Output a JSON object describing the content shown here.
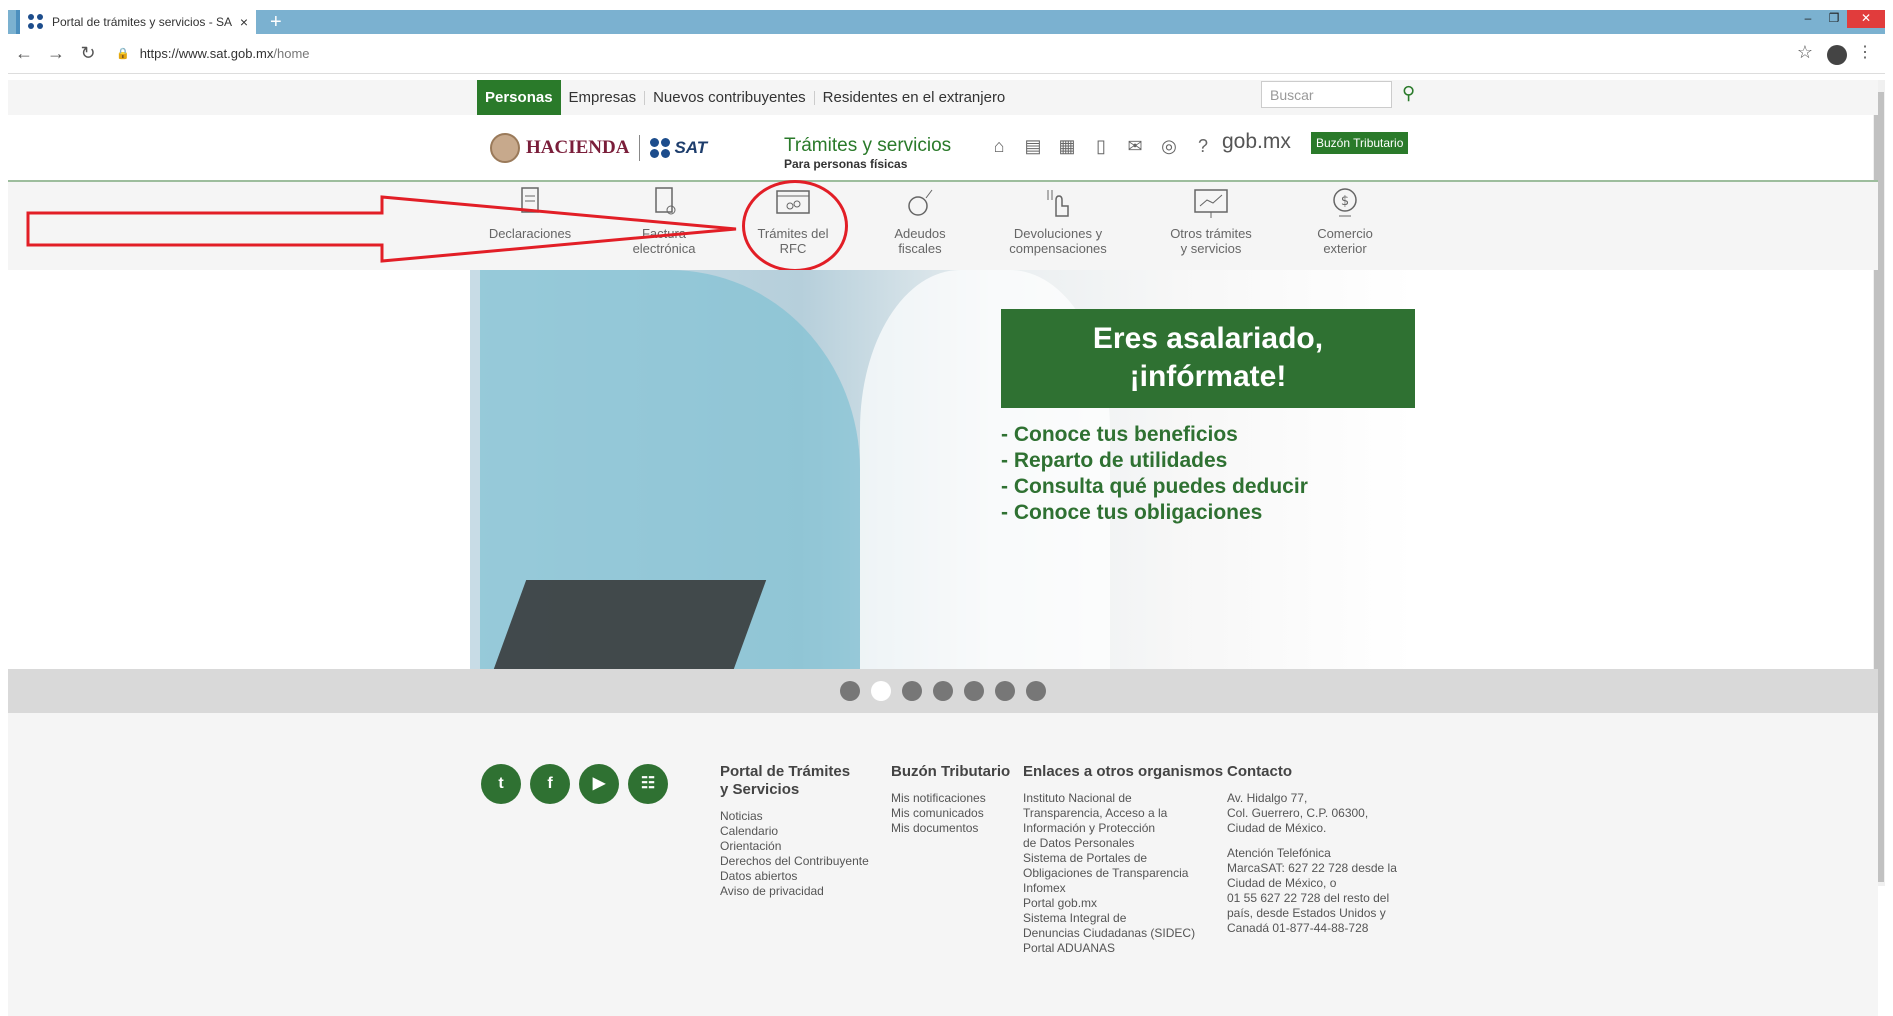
{
  "browser": {
    "tab_title": "Portal de trámites y servicios - SA",
    "tab_close": "×",
    "new_tab": "+",
    "url_host": "https://www.sat.gob.mx",
    "url_path": "/home",
    "win_min": "–",
    "win_max": "❐",
    "win_close": "✕"
  },
  "topnav": {
    "personas": "Personas",
    "links": [
      "Empresas",
      "Nuevos contribuyentes",
      "Residentes en el extranjero"
    ],
    "search_placeholder": "Buscar"
  },
  "header": {
    "hacienda": "HACIENDA",
    "sat": "SAT",
    "title": "Trámites y servicios",
    "subtitle": "Para personas físicas",
    "gobmx": "gob.mx",
    "buzon": "Buzón Tributario",
    "icons": [
      "home-icon",
      "document-icon",
      "calendar-icon",
      "book-icon",
      "mail-icon",
      "compass-icon",
      "help-icon"
    ]
  },
  "services": [
    {
      "label1": "Declaraciones",
      "label2": ""
    },
    {
      "label1": "Factura",
      "label2": "electrónica"
    },
    {
      "label1": "Trámites del",
      "label2": "RFC"
    },
    {
      "label1": "Adeudos",
      "label2": "fiscales"
    },
    {
      "label1": "Devoluciones y",
      "label2": "compensaciones"
    },
    {
      "label1": "Otros trámites",
      "label2": "y servicios"
    },
    {
      "label1": "Comercio",
      "label2": "exterior"
    }
  ],
  "hero": {
    "promo_line1": "Eres asalariado,",
    "promo_line2": "¡infórmate!",
    "bullets": [
      "- Conoce tus beneficios",
      "- Reparto de utilidades",
      "- Consulta qué puedes deducir",
      "- Conoce tus obligaciones"
    ],
    "active_slide": 2,
    "slide_count": 7
  },
  "footer": {
    "social": [
      "twitter-icon",
      "facebook-icon",
      "youtube-icon",
      "sitemap-icon"
    ],
    "col1": {
      "title1": "Portal de Trámites",
      "title2": "y Servicios",
      "items": [
        "Noticias",
        "Calendario",
        "Orientación",
        "Derechos del Contribuyente",
        "Datos abiertos",
        "Aviso de privacidad"
      ]
    },
    "col2": {
      "title": "Buzón Tributario",
      "items": [
        "Mis notificaciones",
        "Mis comunicados",
        "Mis documentos"
      ]
    },
    "col3": {
      "title": "Enlaces a otros organismos",
      "items": [
        "Instituto Nacional de",
        "Transparencia, Acceso a la",
        "Información y Protección",
        "de Datos Personales",
        "Sistema de Portales de",
        "Obligaciones de Transparencia",
        "Infomex",
        "Portal gob.mx",
        "Sistema Integral de",
        "Denuncias Ciudadanas (SIDEC)",
        "Portal ADUANAS"
      ]
    },
    "col4": {
      "title": "Contacto",
      "address": [
        "Av. Hidalgo 77,",
        "Col. Guerrero, C.P. 06300,",
        "Ciudad de México."
      ],
      "phone": [
        "Atención Telefónica",
        "MarcaSAT: 627 22 728 desde la",
        "Ciudad de México, o",
        "01 55 627 22 728 del resto del",
        "país, desde Estados Unidos y",
        "Canadá 01-877-44-88-728"
      ]
    }
  }
}
